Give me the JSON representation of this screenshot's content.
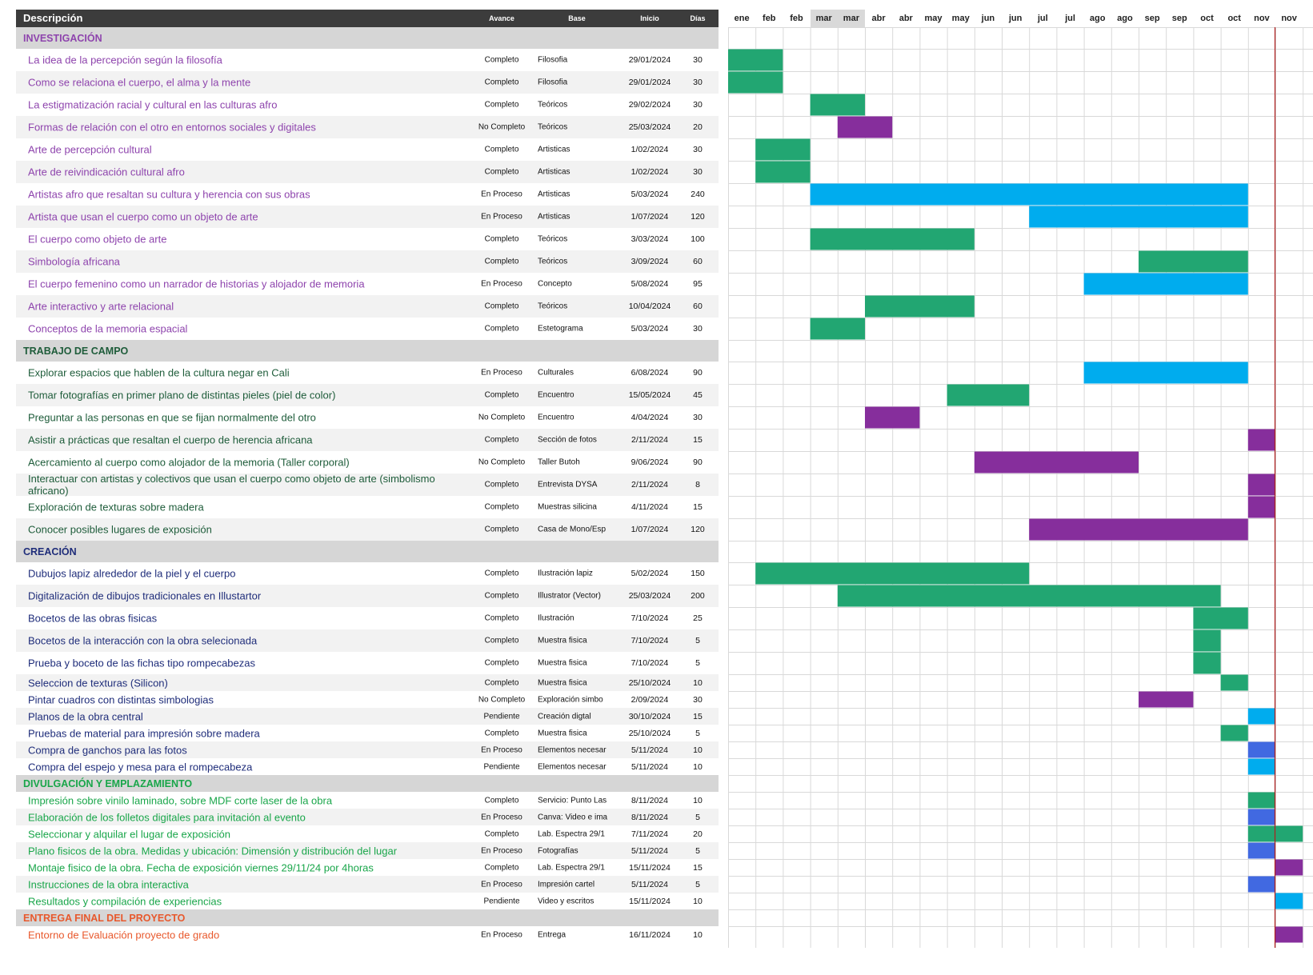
{
  "columns": {
    "desc": "Descripción",
    "avance": "Avance",
    "base": "Base",
    "inicio": "Inicio",
    "dias": "Días"
  },
  "months": [
    "ene",
    "feb",
    "feb",
    "mar",
    "mar",
    "abr",
    "abr",
    "may",
    "may",
    "jun",
    "jun",
    "jul",
    "jul",
    "ago",
    "ago",
    "sep",
    "sep",
    "oct",
    "oct",
    "nov",
    "nov"
  ],
  "colors": {
    "completo": "#22a672",
    "no_completo": "#862e9c",
    "en_proceso": "#00acee",
    "pendiente": "#00acee",
    "en_proceso_late": "#4169e1",
    "today_line": "#b11e1e",
    "grid": "#d9d9d9"
  },
  "sections": [
    {
      "title": "INVESTIGACIÓN",
      "color": "#8e44ad",
      "rows": [
        {
          "desc": "La idea de la percepción según la filosofía",
          "avance": "Completo",
          "base": "Filosofia",
          "inicio": "29/01/2024",
          "dias": "30",
          "bar": {
            "s": 0,
            "e": 2,
            "c": "completo"
          }
        },
        {
          "desc": "Como se relaciona el cuerpo, el alma y la mente",
          "avance": "Completo",
          "base": "Filosofia",
          "inicio": "29/01/2024",
          "dias": "30",
          "bar": {
            "s": 0,
            "e": 2,
            "c": "completo"
          }
        },
        {
          "desc": "La estigmatización racial y cultural en las culturas afro",
          "avance": "Completo",
          "base": "Teóricos",
          "inicio": "29/02/2024",
          "dias": "30",
          "bar": {
            "s": 3,
            "e": 5,
            "c": "completo"
          }
        },
        {
          "desc": "Formas de relación con el otro en entornos sociales y digitales",
          "avance": "No Completo",
          "base": "Teóricos",
          "inicio": "25/03/2024",
          "dias": "20",
          "bar": {
            "s": 4,
            "e": 6,
            "c": "no_completo"
          }
        },
        {
          "desc": "Arte de percepción cultural",
          "avance": "Completo",
          "base": "Artisticas",
          "inicio": "1/02/2024",
          "dias": "30",
          "bar": {
            "s": 1,
            "e": 3,
            "c": "completo"
          }
        },
        {
          "desc": "Arte de reivindicación cultural afro",
          "avance": "Completo",
          "base": "Artisticas",
          "inicio": "1/02/2024",
          "dias": "30",
          "bar": {
            "s": 1,
            "e": 3,
            "c": "completo"
          }
        },
        {
          "desc": "Artistas afro que resaltan su cultura y herencia con sus obras",
          "avance": "En Proceso",
          "base": "Artisticas",
          "inicio": "5/03/2024",
          "dias": "240",
          "bar": {
            "s": 3,
            "e": 19,
            "c": "en_proceso"
          }
        },
        {
          "desc": "Artista que usan el cuerpo como un objeto de arte",
          "avance": "En Proceso",
          "base": "Artisticas",
          "inicio": "1/07/2024",
          "dias": "120",
          "bar": {
            "s": 11,
            "e": 19,
            "c": "en_proceso"
          }
        },
        {
          "desc": "El cuerpo como objeto de arte",
          "avance": "Completo",
          "base": "Teóricos",
          "inicio": "3/03/2024",
          "dias": "100",
          "bar": {
            "s": 3,
            "e": 9,
            "c": "completo"
          }
        },
        {
          "desc": "Simbología africana",
          "avance": "Completo",
          "base": "Teóricos",
          "inicio": "3/09/2024",
          "dias": "60",
          "bar": {
            "s": 15,
            "e": 19,
            "c": "completo"
          }
        },
        {
          "desc": "El cuerpo femenino como un narrador de historias y alojador de memoria",
          "avance": "En Proceso",
          "base": "Concepto",
          "inicio": "5/08/2024",
          "dias": "95",
          "bar": {
            "s": 13,
            "e": 19,
            "c": "en_proceso"
          }
        },
        {
          "desc": "Arte interactivo y arte relacional",
          "avance": "Completo",
          "base": "Teóricos",
          "inicio": "10/04/2024",
          "dias": "60",
          "bar": {
            "s": 5,
            "e": 9,
            "c": "completo"
          }
        },
        {
          "desc": "Conceptos de la memoria espacial",
          "avance": "Completo",
          "base": "Estetograma",
          "inicio": "5/03/2024",
          "dias": "30",
          "bar": {
            "s": 3,
            "e": 5,
            "c": "completo"
          }
        }
      ]
    },
    {
      "title": "TRABAJO DE CAMPO",
      "color": "#1e5c3a",
      "rows": [
        {
          "desc": "Explorar espacios que hablen de la cultura negar en Cali",
          "avance": "En Proceso",
          "base": "Culturales",
          "inicio": "6/08/2024",
          "dias": "90",
          "bar": {
            "s": 13,
            "e": 19,
            "c": "en_proceso"
          }
        },
        {
          "desc": "Tomar fotografías en primer plano de distintas pieles (piel de color)",
          "avance": "Completo",
          "base": "Encuentro",
          "inicio": "15/05/2024",
          "dias": "45",
          "bar": {
            "s": 8,
            "e": 11,
            "c": "completo"
          }
        },
        {
          "desc": "Preguntar a las personas en que se fijan normalmente del otro",
          "avance": "No Completo",
          "base": "Encuentro",
          "inicio": "4/04/2024",
          "dias": "30",
          "bar": {
            "s": 5,
            "e": 7,
            "c": "no_completo"
          }
        },
        {
          "desc": "Asistir a prácticas que resaltan el cuerpo de herencia africana",
          "avance": "Completo",
          "base": "Sección de fotos",
          "inicio": "2/11/2024",
          "dias": "15",
          "bar": {
            "s": 19,
            "e": 20,
            "c": "no_completo"
          }
        },
        {
          "desc": "Acercamiento al cuerpo como alojador de la memoria (Taller corporal)",
          "avance": "No Completo",
          "base": "Taller Butoh",
          "inicio": "9/06/2024",
          "dias": "90",
          "bar": {
            "s": 9,
            "e": 15,
            "c": "no_completo"
          }
        },
        {
          "desc": "Interactuar con artistas y colectivos que usan el cuerpo como objeto de arte (simbolismo africano)",
          "avance": "Completo",
          "base": "Entrevista DYSA",
          "inicio": "2/11/2024",
          "dias": "8",
          "bar": {
            "s": 19,
            "e": 20,
            "c": "no_completo"
          },
          "wrap": true
        },
        {
          "desc": "Exploración de texturas sobre madera",
          "avance": "Completo",
          "base": "Muestras silicina",
          "inicio": "4/11/2024",
          "dias": "15",
          "bar": {
            "s": 19,
            "e": 20,
            "c": "no_completo"
          }
        },
        {
          "desc": "Conocer posibles lugares de exposición",
          "avance": "Completo",
          "base": "Casa de Mono/Esp",
          "inicio": "1/07/2024",
          "dias": "120",
          "bar": {
            "s": 11,
            "e": 19,
            "c": "no_completo"
          }
        }
      ]
    },
    {
      "title": "CREACIÓN",
      "color": "#1f2d7a",
      "rows": [
        {
          "desc": "Dubujos lapiz alrededor de la piel y el cuerpo",
          "avance": "Completo",
          "base": "Ilustración lapiz",
          "inicio": "5/02/2024",
          "dias": "150",
          "bar": {
            "s": 1,
            "e": 11,
            "c": "completo"
          }
        },
        {
          "desc": "Digitalización de dibujos tradicionales en Illustartor",
          "avance": "Completo",
          "base": "Illustrator (Vector)",
          "inicio": "25/03/2024",
          "dias": "200",
          "bar": {
            "s": 4,
            "e": 18,
            "c": "completo"
          }
        },
        {
          "desc": "Bocetos de las obras fisicas",
          "avance": "Completo",
          "base": "Ilustración",
          "inicio": "7/10/2024",
          "dias": "25",
          "bar": {
            "s": 17,
            "e": 19,
            "c": "completo"
          }
        },
        {
          "desc": "Bocetos de la interacción con la obra selecionada",
          "avance": "Completo",
          "base": "Muestra fisica",
          "inicio": "7/10/2024",
          "dias": "5",
          "bar": {
            "s": 17,
            "e": 18,
            "c": "completo"
          }
        },
        {
          "desc": "Prueba y boceto de las fichas tipo rompecabezas",
          "avance": "Completo",
          "base": "Muestra fisica",
          "inicio": "7/10/2024",
          "dias": "5",
          "bar": {
            "s": 17,
            "e": 18,
            "c": "completo"
          }
        },
        {
          "desc": "Seleccion de texturas (Silicon)",
          "avance": "Completo",
          "base": "Muestra fisica",
          "inicio": "25/10/2024",
          "dias": "10",
          "bar": {
            "s": 18,
            "e": 19,
            "c": "completo"
          }
        },
        {
          "desc": "Pintar cuadros con distintas simbologias",
          "avance": "No Completo",
          "base": "Exploración simbo",
          "inicio": "2/09/2024",
          "dias": "30",
          "bar": {
            "s": 15,
            "e": 17,
            "c": "no_completo"
          }
        },
        {
          "desc": "Planos de la obra central",
          "avance": "Pendiente",
          "base": "Creación digtal",
          "inicio": "30/10/2024",
          "dias": "15",
          "bar": {
            "s": 19,
            "e": 20,
            "c": "pendiente"
          }
        },
        {
          "desc": "Pruebas de material para impresión sobre madera",
          "avance": "Completo",
          "base": "Muestra fisica",
          "inicio": "25/10/2024",
          "dias": "5",
          "bar": {
            "s": 18,
            "e": 19,
            "c": "completo"
          }
        },
        {
          "desc": "Compra de ganchos para las fotos",
          "avance": "En Proceso",
          "base": "Elementos necesar",
          "inicio": "5/11/2024",
          "dias": "10",
          "bar": {
            "s": 19,
            "e": 20,
            "c": "en_proceso_late"
          }
        },
        {
          "desc": "Compra del espejo y mesa para el rompecabeza",
          "avance": "Pendiente",
          "base": "Elementos necesar",
          "inicio": "5/11/2024",
          "dias": "10",
          "bar": {
            "s": 19,
            "e": 20,
            "c": "pendiente"
          }
        }
      ]
    },
    {
      "title": "DIVULGACIÓN Y EMPLAZAMIENTO",
      "color": "#19a64a",
      "rows": [
        {
          "desc": "Impresión sobre vinilo laminado, sobre MDF corte laser de la obra",
          "avance": "Completo",
          "base": "Servicio: Punto Las",
          "inicio": "8/11/2024",
          "dias": "10",
          "bar": {
            "s": 19,
            "e": 20,
            "c": "completo"
          }
        },
        {
          "desc": "Elaboración de los folletos digitales para invitación al evento",
          "avance": "En Proceso",
          "base": "Canva: Video e ima",
          "inicio": "8/11/2024",
          "dias": "5",
          "bar": {
            "s": 19,
            "e": 20,
            "c": "en_proceso_late"
          }
        },
        {
          "desc": "Seleccionar y alquilar el lugar de exposición",
          "avance": "Completo",
          "base": "Lab. Espectra 29/1",
          "inicio": "7/11/2024",
          "dias": "20",
          "bar": {
            "s": 19,
            "e": 21,
            "c": "completo"
          }
        },
        {
          "desc": "Plano fisicos de la obra. Medidas y ubicación: Dimensión y distribución del lugar",
          "avance": "En Proceso",
          "base": "Fotografías",
          "inicio": "5/11/2024",
          "dias": "5",
          "bar": {
            "s": 19,
            "e": 20,
            "c": "en_proceso_late"
          }
        },
        {
          "desc": "Montaje fisico de la obra. Fecha de exposición viernes 29/11/24 por 4horas",
          "avance": "Completo",
          "base": "Lab. Espectra 29/1",
          "inicio": "15/11/2024",
          "dias": "15",
          "bar": {
            "s": 20,
            "e": 21,
            "c": "no_completo"
          }
        },
        {
          "desc": "Instrucciones de la obra interactiva",
          "avance": "En Proceso",
          "base": "Impresión cartel",
          "inicio": "5/11/2024",
          "dias": "5",
          "bar": {
            "s": 19,
            "e": 20,
            "c": "en_proceso_late"
          }
        },
        {
          "desc": "Resultados y compilación de experiencias",
          "avance": "Pendiente",
          "base": "Video y escritos",
          "inicio": "15/11/2024",
          "dias": "10",
          "bar": {
            "s": 20,
            "e": 21,
            "c": "pendiente"
          }
        }
      ]
    },
    {
      "title": "ENTREGA FINAL DEL PROYECTO",
      "color": "#e8582c",
      "rows": [
        {
          "desc": "Entorno de Evaluación proyecto de grado",
          "avance": "En Proceso",
          "base": "Entrega",
          "inicio": "16/11/2024",
          "dias": "10",
          "bar": {
            "s": 20,
            "e": 21,
            "c": "no_completo"
          }
        }
      ]
    }
  ]
}
